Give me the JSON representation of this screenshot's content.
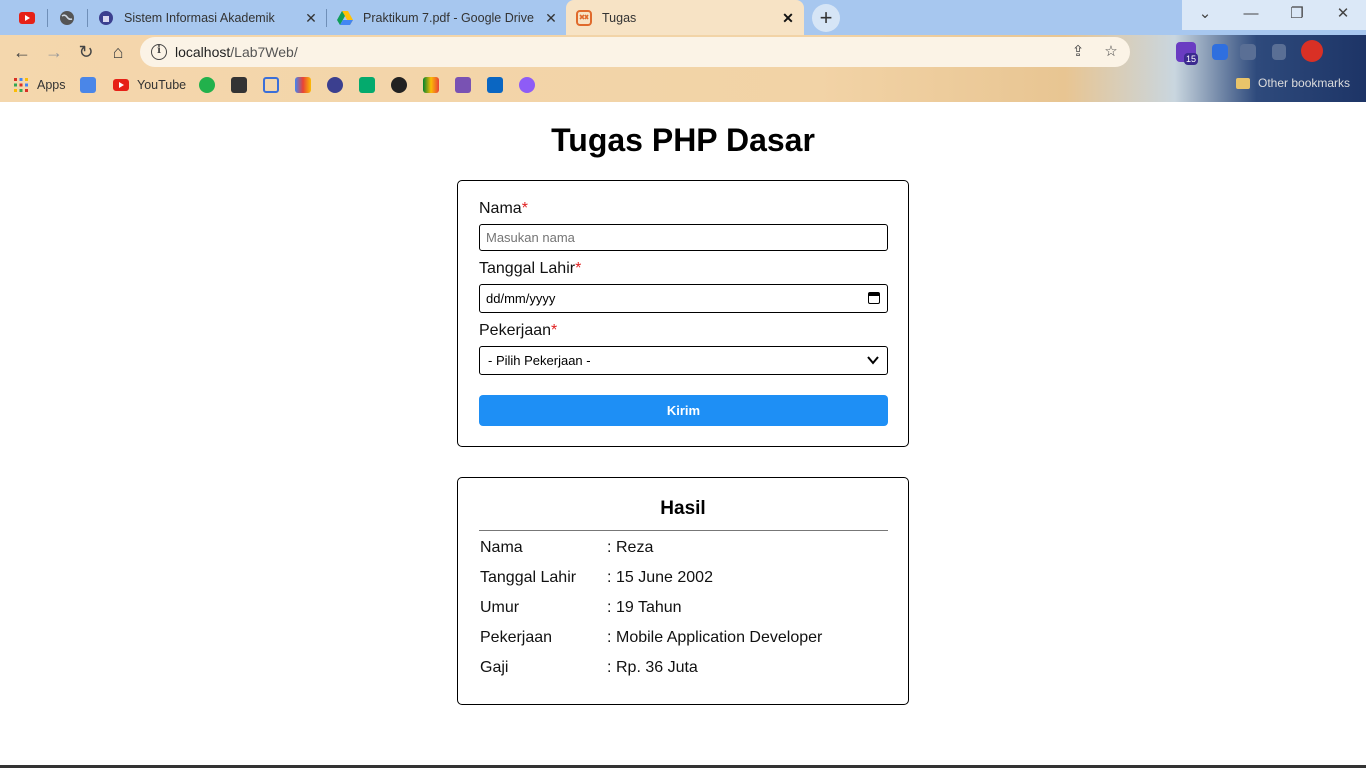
{
  "browser": {
    "tabs": [
      {
        "title": "",
        "icon": "youtube-icon"
      },
      {
        "title": "",
        "icon": "globe-icon"
      },
      {
        "title": "Sistem Informasi Akademik",
        "icon": "university-icon"
      },
      {
        "title": "Praktikum 7.pdf - Google Drive",
        "icon": "google-drive-icon"
      },
      {
        "title": "Tugas",
        "icon": "html5-icon"
      }
    ],
    "url_host": "localhost",
    "url_path": "/Lab7Web/",
    "extension_badge": "15",
    "bookmarks": [
      {
        "label": "Apps",
        "icon": "apps-grid-icon"
      },
      {
        "label": "",
        "icon": "google-translate-icon"
      },
      {
        "label": "YouTube",
        "icon": "youtube-icon"
      },
      {
        "label": "",
        "icon": "counter-81-icon"
      },
      {
        "label": "",
        "icon": "g-square-icon"
      },
      {
        "label": "",
        "icon": "flag-icon"
      },
      {
        "label": "",
        "icon": "gmail-icon"
      },
      {
        "label": "",
        "icon": "university-icon"
      },
      {
        "label": "",
        "icon": "w3schools-icon"
      },
      {
        "label": "",
        "icon": "github-icon"
      },
      {
        "label": "",
        "icon": "google-meet-icon"
      },
      {
        "label": "",
        "icon": "bootstrap-icon"
      },
      {
        "label": "",
        "icon": "linkedin-icon"
      },
      {
        "label": "",
        "icon": "search-app-icon"
      }
    ],
    "other_bookmarks": "Other bookmarks"
  },
  "page": {
    "title": "Tugas PHP Dasar",
    "form": {
      "nama_label": "Nama",
      "nama_placeholder": "Masukan nama",
      "tanggal_label": "Tanggal Lahir",
      "tanggal_value": "dd/mm/yyyy",
      "pekerjaan_label": "Pekerjaan",
      "pekerjaan_value": "- Pilih Pekerjaan -",
      "required_mark": "*",
      "submit_label": "Kirim"
    },
    "result": {
      "title": "Hasil",
      "rows": [
        {
          "key": "Nama",
          "value": "Reza"
        },
        {
          "key": "Tanggal Lahir",
          "value": "15 June 2002"
        },
        {
          "key": "Umur",
          "value": "19 Tahun"
        },
        {
          "key": "Pekerjaan",
          "value": "Mobile Application Developer"
        },
        {
          "key": "Gaji",
          "value": "Rp. 36 Juta"
        }
      ],
      "separator": ":"
    }
  },
  "colors": {
    "submit_bg": "#1e8ff5",
    "required": "#e02020",
    "tabstrip": "#a7c7ef"
  }
}
